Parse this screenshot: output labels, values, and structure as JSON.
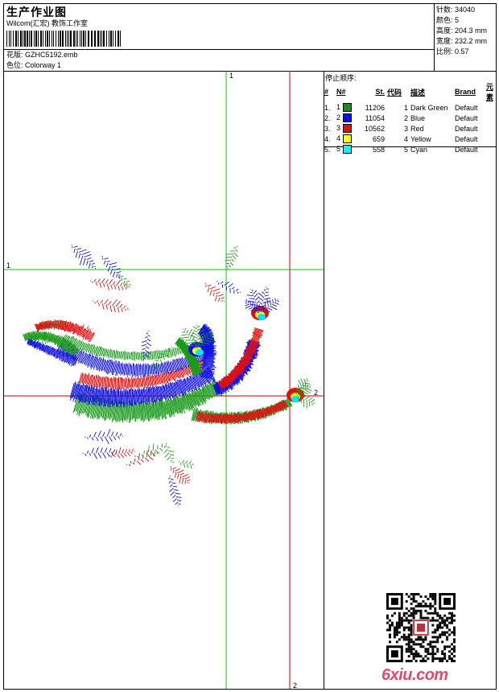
{
  "header": {
    "title": "生产作业图",
    "company": "Wilcom(汇宏) 教饰工作室",
    "design_file_label": "花版:",
    "design_file": "GZHC5192.emb",
    "colorway_label": "色位:",
    "colorway": "Colorway 1"
  },
  "specs": {
    "stitches_label": "针数:",
    "stitches": "34040",
    "colors_label": "颜色:",
    "colors": "5",
    "height_label": "高度:",
    "height": "204.3 mm",
    "width_label": "宽度:",
    "width": "232.2 mm",
    "scale_label": "比例:",
    "scale": "0.57"
  },
  "stop_order": {
    "title": "停止顺序:",
    "columns": [
      "#",
      "N#",
      "St.",
      "代码",
      "描述",
      "Brand",
      "元素"
    ],
    "rows": [
      {
        "idx": "1.",
        "n": "1",
        "stitches": "11206",
        "code": "1",
        "desc": "Dark Green",
        "brand": "Default",
        "color": "#1a8c1a"
      },
      {
        "idx": "2.",
        "n": "2",
        "stitches": "11054",
        "code": "2",
        "desc": "Blue",
        "brand": "Default",
        "color": "#1010e0"
      },
      {
        "idx": "3.",
        "n": "3",
        "stitches": "10562",
        "code": "3",
        "desc": "Red",
        "brand": "Default",
        "color": "#e01010"
      },
      {
        "idx": "4.",
        "n": "4",
        "stitches": "659",
        "code": "4",
        "desc": "Yellow",
        "brand": "Default",
        "color": "#ffff00"
      },
      {
        "idx": "5.",
        "n": "5",
        "stitches": "558",
        "code": "5",
        "desc": "Cyan",
        "brand": "Default",
        "color": "#00ffff"
      }
    ]
  },
  "design": {
    "axis_labels": {
      "green_v_top": "1",
      "green_h_left": "1",
      "red_h_right": "2",
      "red_v_bottom": "2"
    },
    "guide_green": "#00cc00",
    "guide_red": "#cc0000"
  },
  "watermark": {
    "text": "6xiu.com"
  }
}
